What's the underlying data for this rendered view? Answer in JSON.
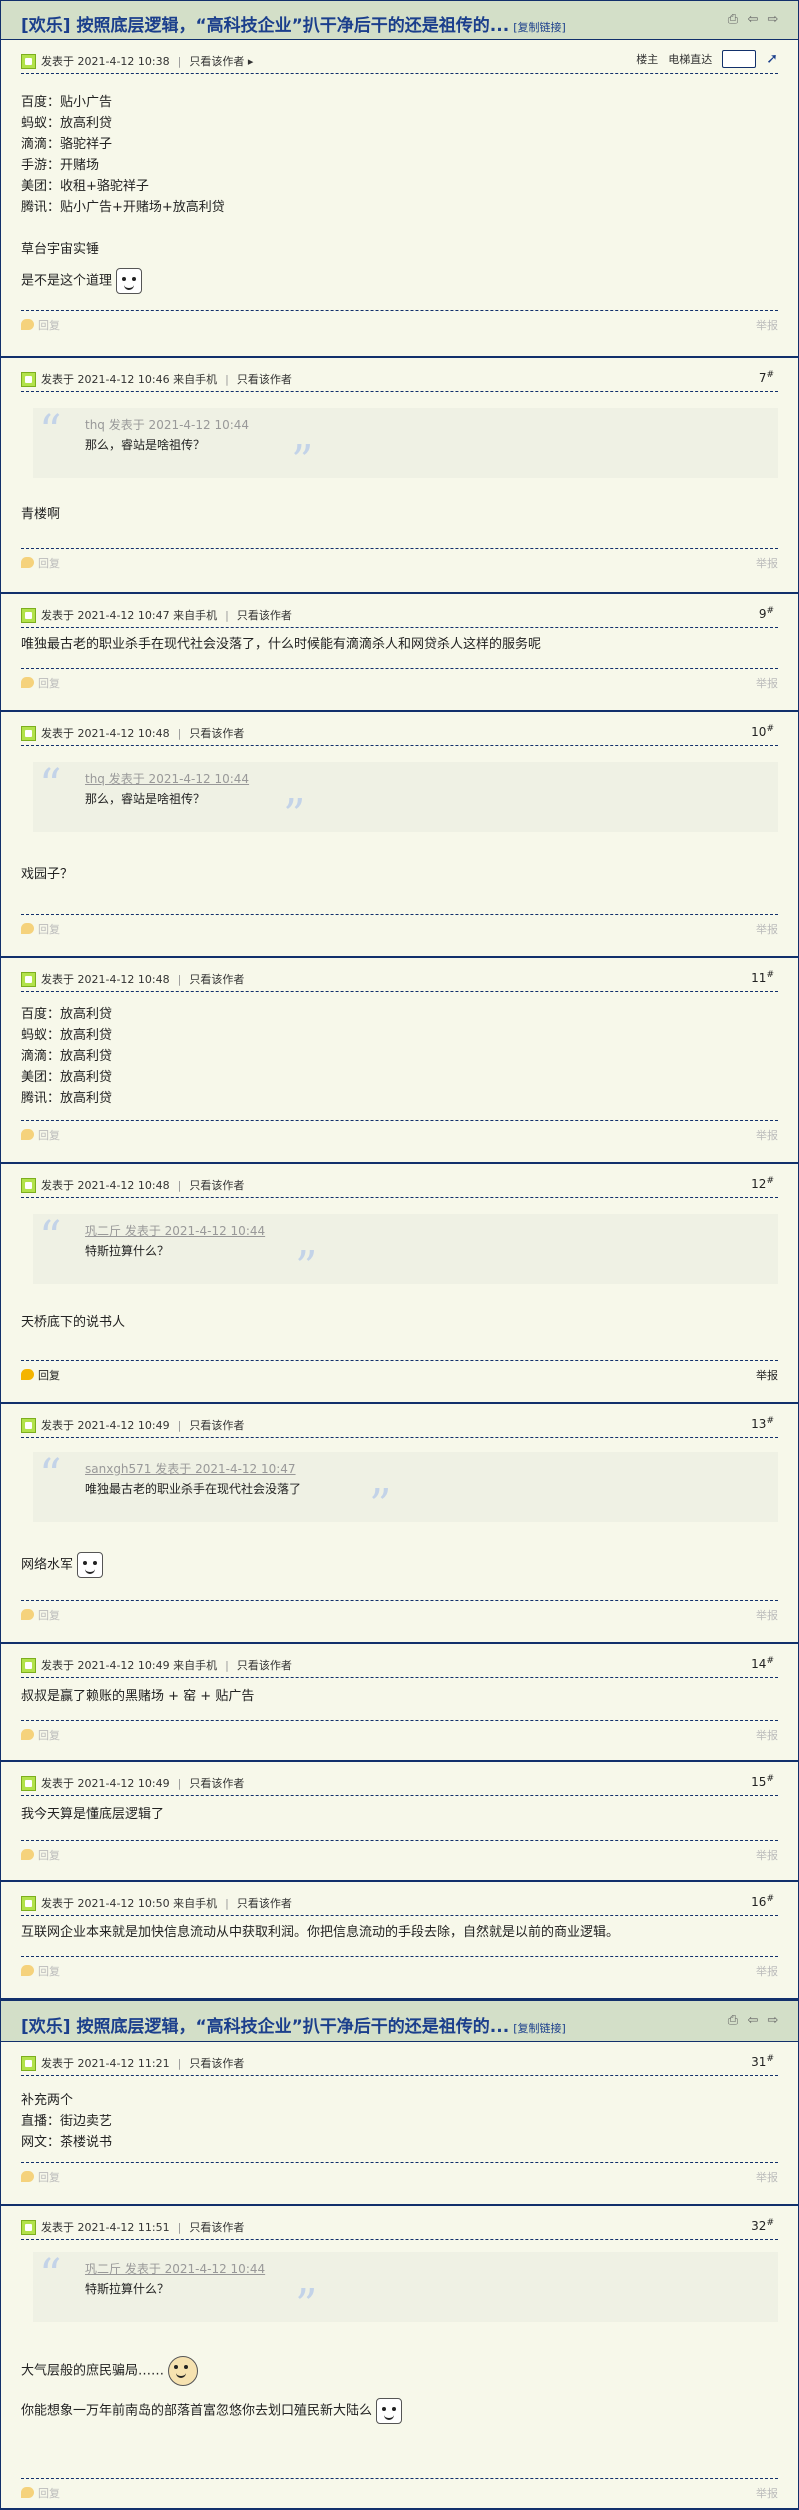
{
  "thread": {
    "title": "[欢乐] 按照底层逻辑，“高科技企业”扒干净后干的还是祖传的...",
    "copy_link": "[复制链接]"
  },
  "labels": {
    "posted": "发表于",
    "from_mobile": "来自手机",
    "only_author": "只看该作者",
    "reply": "回复",
    "report": "举报",
    "floor_owner": "楼主",
    "jump_to_floor": "电梯直达",
    "floor_mark": "#"
  },
  "posts": [
    {
      "time": "2021-4-12 10:38",
      "lines": [
        "百度：贴小广告",
        "蚂蚁：放高利贷",
        "滴滴：骆驼祥子",
        "手游：开赌场",
        "美团：收租+骆驼祥子",
        "腾讯：贴小广告+开赌场+放高利贷",
        "",
        "草台宇宙实锤",
        "是不是这个道理"
      ]
    },
    {
      "time": "2021-4-12 10:46",
      "floor": "7",
      "quote": {
        "author": "thq 发表于 2021-4-12 10:44",
        "text": "那么，睿站是啥祖传？"
      },
      "lines": [
        "青楼啊"
      ]
    },
    {
      "time": "2021-4-12 10:47",
      "floor": "9",
      "lines": [
        "唯独最古老的职业杀手在现代社会没落了，什么时候能有滴滴杀人和网贷杀人这样的服务呢"
      ]
    },
    {
      "time": "2021-4-12 10:48",
      "floor": "10",
      "quote": {
        "author": "thq 发表于 2021-4-12 10:44",
        "text": "那么，睿站是啥祖传？"
      },
      "lines": [
        "戏园子？"
      ]
    },
    {
      "time": "2021-4-12 10:48",
      "floor": "11",
      "lines": [
        "百度：放高利贷",
        "蚂蚁：放高利贷",
        "滴滴：放高利贷",
        "美团：放高利贷",
        "腾讯：放高利贷"
      ]
    },
    {
      "time": "2021-4-12 10:48",
      "floor": "12",
      "quote": {
        "author": "巩二斤 发表于 2021-4-12 10:44",
        "text": "特斯拉算什么？"
      },
      "lines": [
        "天桥底下的说书人"
      ]
    },
    {
      "time": "2021-4-12 10:49",
      "floor": "13",
      "quote": {
        "author": "sanxgh571 发表于 2021-4-12 10:47",
        "text": "唯独最古老的职业杀手在现代社会没落了"
      },
      "lines": [
        "网络水军"
      ]
    },
    {
      "time": "2021-4-12 10:49",
      "floor": "14",
      "lines": [
        "叔叔是赢了赖账的黑赌场 + 窑 + 贴广告"
      ]
    },
    {
      "time": "2021-4-12 10:49",
      "floor": "15",
      "lines": [
        "我今天算是懂底层逻辑了"
      ]
    },
    {
      "time": "2021-4-12 10:50",
      "floor": "16",
      "lines": [
        "互联网企业本来就是加快信息流动从中获取利润。你把信息流动的手段去除，自然就是以前的商业逻辑。"
      ]
    },
    {
      "time": "2021-4-12 11:21",
      "floor": "31",
      "lines": [
        "补充两个",
        "直播：街边卖艺",
        "网文：茶楼说书"
      ]
    },
    {
      "time": "2021-4-12 11:51",
      "floor": "32",
      "quote": {
        "author": "巩二斤 发表于 2021-4-12 10:44",
        "text": "特斯拉算什么？"
      },
      "lines": [
        "大气层般的庶民骗局……",
        "",
        "你能想象一万年前南岛的部落首富忽悠你去划口殖民新大陆么"
      ]
    }
  ]
}
